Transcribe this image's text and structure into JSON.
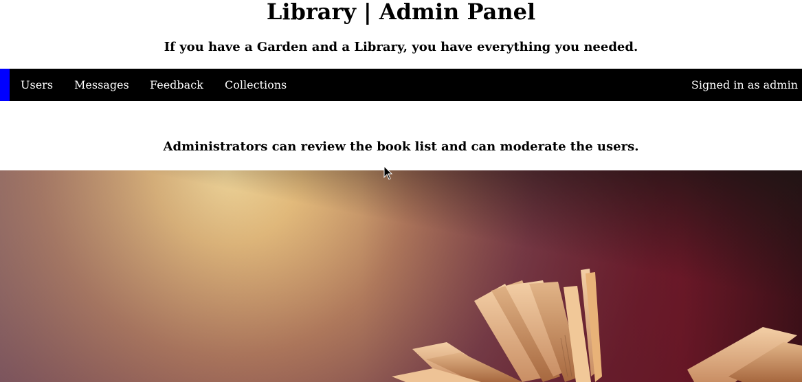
{
  "header": {
    "title": "Library | Admin Panel",
    "tagline": "If you have a Garden and a Library, you have everything you needed."
  },
  "navbar": {
    "accent_color": "#0000ff",
    "background_color": "#000000",
    "items": [
      {
        "label": "Users"
      },
      {
        "label": "Messages"
      },
      {
        "label": "Feedback"
      },
      {
        "label": "Collections"
      }
    ],
    "signed_in_text": "Signed in as admin"
  },
  "main": {
    "intro_text": "Administrators can review the book list and can moderate the users.",
    "hero_image": "open-book-photo"
  }
}
